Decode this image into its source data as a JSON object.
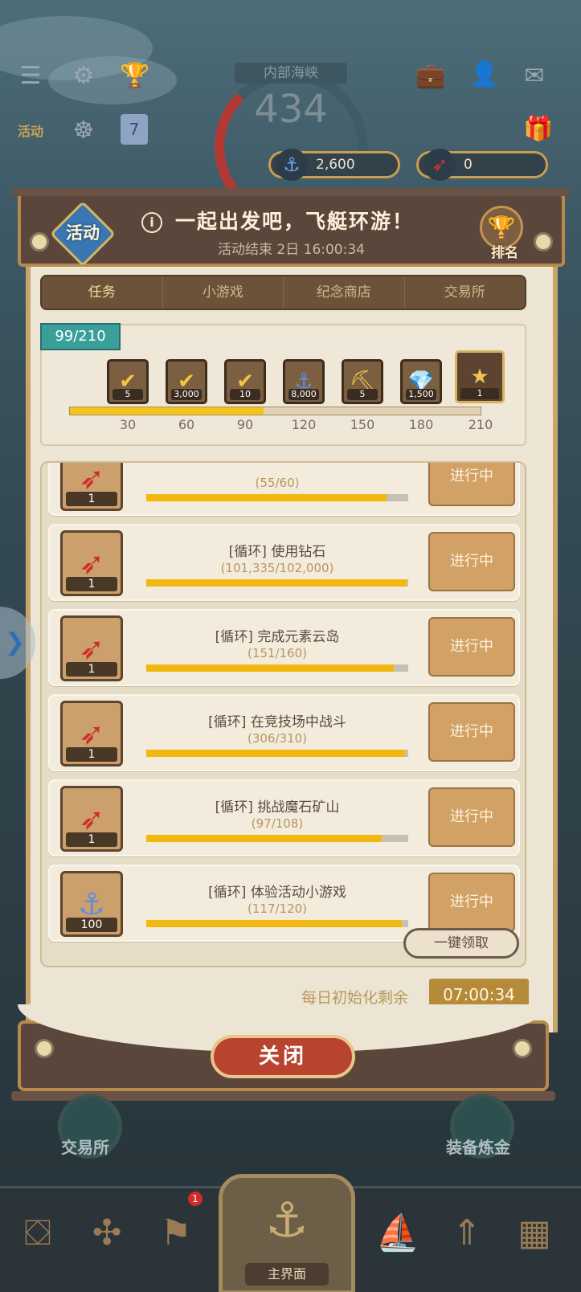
{
  "top": {
    "zone_label": "内部海峡",
    "zone_number": "434",
    "currency_anchor": "2,600",
    "currency_dart": "0",
    "activity_icon_label": "活动",
    "calendar_day": "7",
    "gift_label": "新手礼包"
  },
  "event": {
    "logo_text": "活动",
    "title": "一起出发吧，飞艇环游！",
    "subtitle": "活动结束 2日 16:00:34",
    "rank_label": "排名"
  },
  "tabs": [
    "任务",
    "小游戏",
    "纪念商店",
    "交易所"
  ],
  "progress": {
    "current": 99,
    "max": 210,
    "label": "99/210",
    "fraction": 0.471,
    "rewards": [
      {
        "icon": "check-ticket-icon",
        "glyph": "✔",
        "qty": "5"
      },
      {
        "icon": "check-ticket-icon",
        "glyph": "✔",
        "qty": "3,000"
      },
      {
        "icon": "check-ticket-icon",
        "glyph": "✔",
        "qty": "10"
      },
      {
        "icon": "anchor-icon",
        "glyph": "⚓",
        "qty": "8,000"
      },
      {
        "icon": "pickaxe-icon",
        "glyph": "⛏",
        "qty": "5"
      },
      {
        "icon": "diamond-icon",
        "glyph": "💎",
        "qty": "1,500"
      },
      {
        "icon": "star-chest-icon",
        "glyph": "★",
        "qty": "1"
      }
    ],
    "ticks": [
      "30",
      "60",
      "90",
      "120",
      "150",
      "180",
      "210"
    ]
  },
  "tasks": [
    {
      "name": "",
      "progress_text": "(55/60)",
      "fraction": 0.917,
      "reward_qty": "1",
      "reward_icon": "dart-icon",
      "button": "进行中"
    },
    {
      "name": "[循环] 使用钻石",
      "progress_text": "(101,335/102,000)",
      "fraction": 0.993,
      "reward_qty": "1",
      "reward_icon": "dart-icon",
      "button": "进行中"
    },
    {
      "name": "[循环] 完成元素云岛",
      "progress_text": "(151/160)",
      "fraction": 0.944,
      "reward_qty": "1",
      "reward_icon": "dart-icon",
      "button": "进行中"
    },
    {
      "name": "[循环] 在竞技场中战斗",
      "progress_text": "(306/310)",
      "fraction": 0.987,
      "reward_qty": "1",
      "reward_icon": "dart-icon",
      "button": "进行中"
    },
    {
      "name": "[循环] 挑战魔石矿山",
      "progress_text": "(97/108)",
      "fraction": 0.898,
      "reward_qty": "1",
      "reward_icon": "dart-icon",
      "button": "进行中"
    },
    {
      "name": "[循环] 体验活动小游戏",
      "progress_text": "(117/120)",
      "fraction": 0.975,
      "reward_qty": "100",
      "reward_icon": "anchor-icon",
      "button": "进行中"
    }
  ],
  "claim_all": "一键领取",
  "reset": {
    "label": "每日初始化剩余",
    "time": "07:00:34"
  },
  "close": "关闭",
  "bottom": {
    "exchange_label": "交易所",
    "alchemy_label": "装备炼金",
    "main_label": "主界面",
    "badge": "1"
  },
  "colors": {
    "progress_fill": "#f5c41b",
    "task_fill": "#f3b810",
    "accent_teal": "#3a9f98"
  }
}
